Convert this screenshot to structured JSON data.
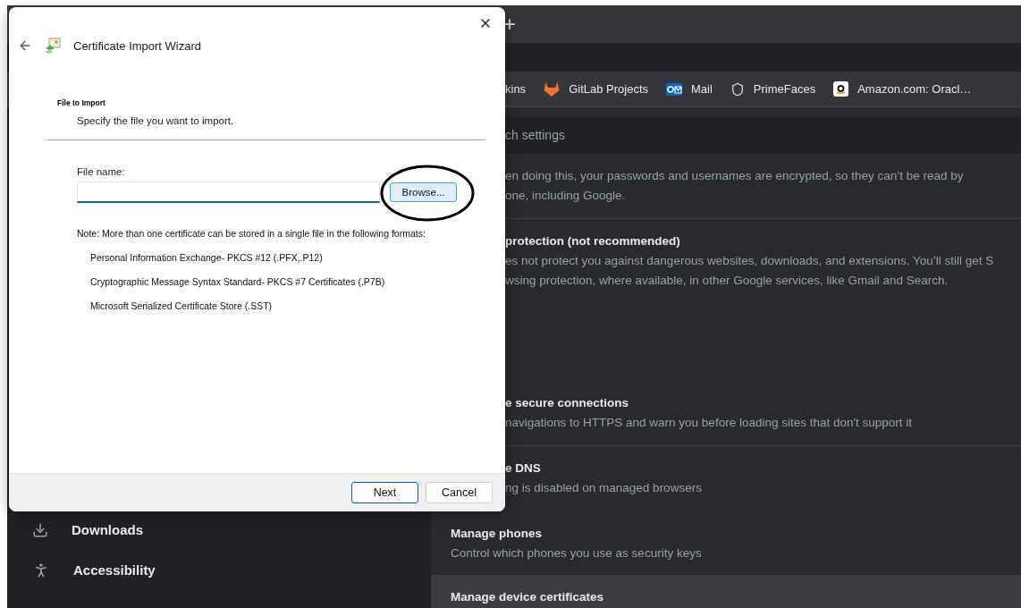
{
  "browser": {
    "new_tab": "+",
    "bookmarks": [
      {
        "label": "kins",
        "kind": "plain"
      },
      {
        "label": "GitLab Projects",
        "kind": "fox"
      },
      {
        "label": "Mail",
        "kind": "envelope"
      },
      {
        "label": "PrimeFaces",
        "kind": "shield"
      },
      {
        "label": "Amazon.com: Oracl…",
        "kind": "smile"
      }
    ],
    "search": {
      "placeholder": "ch settings"
    },
    "sidebar": {
      "items": [
        {
          "label": "Downloads",
          "kind": "download"
        },
        {
          "label": "Accessibility",
          "kind": "person"
        }
      ]
    },
    "settings_rows": [
      {
        "kind": "option",
        "lines": [
          "en doing this, your passwords and usernames are encrypted, so they can’t be read by",
          "one, including Google."
        ],
        "divider": true,
        "highlighted": false
      },
      {
        "kind": "option",
        "title": "protection (not recommended)",
        "lines": [
          "es not protect you against dangerous websites, downloads, and extensions. You’ll still get S",
          "wsing protection, where available, in other Google services, like Gmail and Search."
        ],
        "divider": false,
        "highlighted": false
      },
      {
        "kind": "option",
        "title": "e secure connections",
        "lines": [
          "navigations to HTTPS and warn you before loading sites that don't support it"
        ],
        "divider": true,
        "highlighted": false
      },
      {
        "kind": "option",
        "title": "e DNS",
        "lines": [
          "ng is disabled on managed browsers"
        ],
        "divider": false,
        "highlighted": false
      },
      {
        "kind": "link",
        "title": "Manage phones",
        "lines": [
          "Control which phones you use as security keys"
        ],
        "divider": false,
        "highlighted": false
      },
      {
        "kind": "link",
        "title": "Manage device certificates",
        "lines": [],
        "divider": false,
        "highlighted": true
      }
    ]
  },
  "dialog": {
    "title": "Certificate Import Wizard",
    "section_title": "File to Import",
    "instruction": "Specify the file you want to import.",
    "file_name": {
      "label": "File name:"
    },
    "browse_button": "Browse...",
    "note": "Note:  More than one certificate can be stored in a single file in the following formats:",
    "formats": [
      "Personal Information Exchange- PKCS #12 (.PFX,.P12)",
      "Cryptographic Message Syntax Standard- PKCS #7 Certificates (.P7B)",
      "Microsoft Serialized Certificate Store (.SST)"
    ],
    "buttons": [
      {
        "label": "Next",
        "default": true
      },
      {
        "label": "Cancel",
        "default": false
      }
    ]
  }
}
